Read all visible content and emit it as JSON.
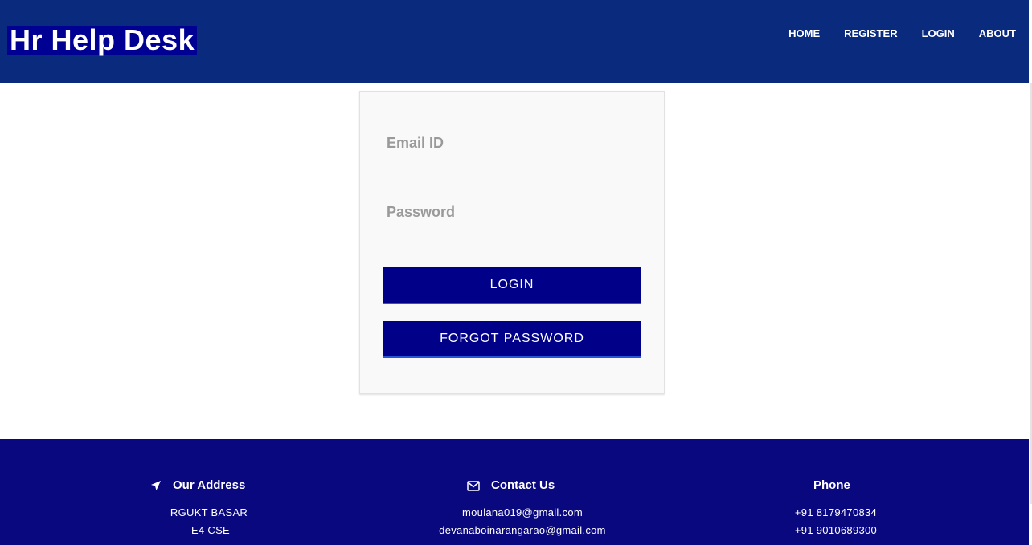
{
  "header": {
    "brand": "Hr Help Desk",
    "nav": [
      "HOME",
      "REGISTER",
      "LOGIN",
      "ABOUT"
    ]
  },
  "login": {
    "email_placeholder": "Email ID",
    "password_placeholder": "Password",
    "login_label": "LOGIN",
    "forgot_label": "FORGOT PASSWORD"
  },
  "footer": {
    "address": {
      "title": "Our Address",
      "icon": "location-arrow-icon",
      "lines": [
        "RGUKT BASAR",
        "E4 CSE"
      ]
    },
    "contact": {
      "title": "Contact Us",
      "icon": "envelope-icon",
      "lines": [
        "moulana019@gmail.com",
        "devanaboinarangarao@gmail.com"
      ]
    },
    "phone": {
      "title": "Phone",
      "lines": [
        "+91 8179470834",
        "+91 9010689300"
      ]
    }
  },
  "colors": {
    "header_bg": "#0a2a7e",
    "brand_bg": "#000092",
    "button_bg": "#000088",
    "footer_bg": "#0a087e",
    "card_bg": "#f9f9f9"
  }
}
